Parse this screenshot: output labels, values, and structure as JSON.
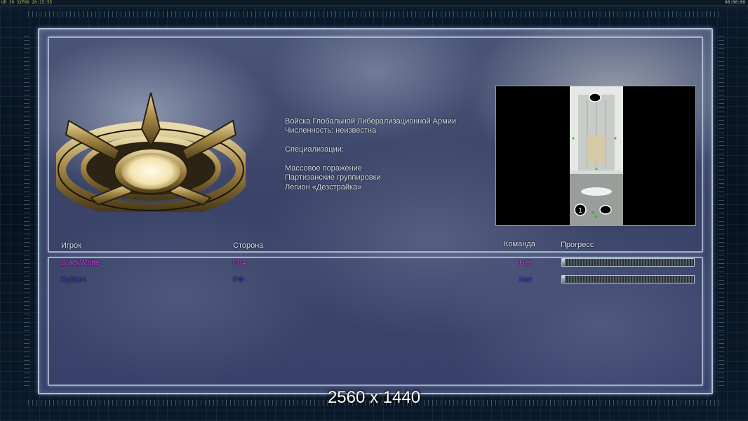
{
  "hud": {
    "left": "UR 30 32F60 20:15:55",
    "right": "00:00:00"
  },
  "faction": {
    "lines": [
      "Войска Глобальной Либерализационной Армии",
      "Численность: неизвестна",
      "",
      "Специализации:",
      "",
      "Массовое поражение",
      "Партизанские группировки",
      "Легион «Дезстрайка»"
    ]
  },
  "table": {
    "headers": {
      "player": "Игрок",
      "side": "Сторона",
      "team": "Команда",
      "progress": "Прогресс"
    },
    "rows": [
      {
        "player": "BlackWhite",
        "side": "ГЛА",
        "team": "Нет",
        "progress": 0.01,
        "color": "#c040d0"
      },
      {
        "player": "KyIIloH",
        "side": "РФ",
        "team": "Нет",
        "progress": 0.01,
        "color": "#2a34d8"
      }
    ]
  },
  "minimap": {
    "start_positions": [
      "1"
    ]
  },
  "watermark": "2560 x 1440",
  "colors": {
    "frame": "#a9c0d6",
    "text": "#d6dbe4",
    "emblem_gold": "#b89a58"
  }
}
